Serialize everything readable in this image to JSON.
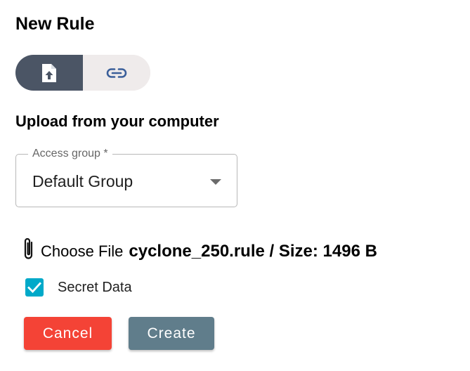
{
  "dialog": {
    "title": "New Rule",
    "subtitle": "Upload from your computer"
  },
  "source_toggle": {
    "options": [
      {
        "icon": "file-upload-icon",
        "active": true
      },
      {
        "icon": "link-icon",
        "active": false
      }
    ]
  },
  "access_group": {
    "label": "Access group *",
    "value": "Default Group"
  },
  "file": {
    "icon": "paperclip-icon",
    "choose_label": "Choose File",
    "info": "cyclone_250.rule / Size: 1496 B"
  },
  "secret": {
    "label": "Secret Data",
    "checked": true
  },
  "actions": {
    "cancel_label": "Cancel",
    "create_label": "Create"
  },
  "colors": {
    "toggle_active": "#4b5565",
    "toggle_inactive": "#efebeb",
    "checkbox": "#00a9c9",
    "cancel": "#f44336",
    "create": "#607d8b",
    "link_icon": "#3b5f9a"
  }
}
